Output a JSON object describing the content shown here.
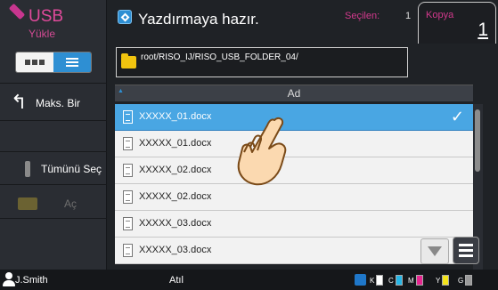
{
  "sidebar": {
    "title": "USB",
    "subtitle": "Yükle",
    "max_label": "Maks. Bir",
    "select_all_label": "Tümünü Seç",
    "open_label": "Aç"
  },
  "header": {
    "status": "Yazdırmaya hazır.",
    "selected_label": "Seçilen:",
    "selected_count": "1",
    "copies_label": "Kopya",
    "copies_value": "1",
    "path": "root/RISO_IJ/RISO_USB_FOLDER_04/"
  },
  "list": {
    "column_header": "Ad",
    "files": [
      {
        "name": "XXXXX_01.docx",
        "selected": true
      },
      {
        "name": "XXXXX_01.docx",
        "selected": false
      },
      {
        "name": "XXXXX_02.docx",
        "selected": false
      },
      {
        "name": "XXXXX_02.docx",
        "selected": false
      },
      {
        "name": "XXXXX_03.docx",
        "selected": false
      },
      {
        "name": "XXXXX_03.docx",
        "selected": false
      }
    ]
  },
  "footer": {
    "user": "J.Smith",
    "status": "Atıl",
    "inks": [
      {
        "label": "K",
        "color": "#ffffff"
      },
      {
        "label": "C",
        "color": "#27b6e6"
      },
      {
        "label": "M",
        "color": "#e6258f"
      },
      {
        "label": "Y",
        "color": "#f4e41a"
      },
      {
        "label": "G",
        "color": "#9a9a9a"
      }
    ]
  },
  "colors": {
    "accent": "#2e8fd3",
    "brand_pink": "#d2398c",
    "selected_row": "#49a6e3"
  }
}
